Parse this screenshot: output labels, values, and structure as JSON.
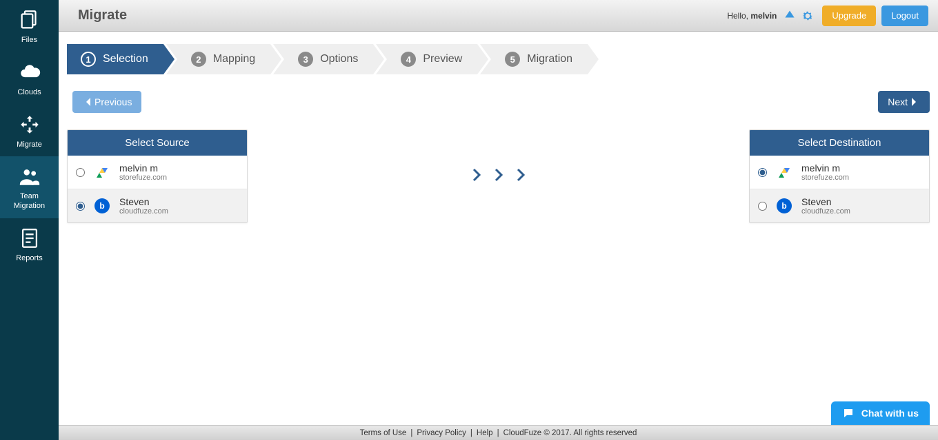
{
  "sidebar": {
    "items": [
      {
        "label": "Files"
      },
      {
        "label": "Clouds"
      },
      {
        "label": "Migrate"
      },
      {
        "label": "Team\nMigration"
      },
      {
        "label": "Reports"
      }
    ]
  },
  "header": {
    "title": "Migrate",
    "hello_prefix": "Hello, ",
    "username": "melvin",
    "upgrade_label": "Upgrade",
    "logout_label": "Logout"
  },
  "wizard": {
    "steps": [
      {
        "num": "1",
        "label": "Selection"
      },
      {
        "num": "2",
        "label": "Mapping"
      },
      {
        "num": "3",
        "label": "Options"
      },
      {
        "num": "4",
        "label": "Preview"
      },
      {
        "num": "5",
        "label": "Migration"
      }
    ],
    "prev_label": "Previous",
    "next_label": "Next"
  },
  "source": {
    "title": "Select Source",
    "items": [
      {
        "name": "melvin m",
        "domain": "storefuze.com",
        "icon": "gdrive",
        "selected": false
      },
      {
        "name": "Steven",
        "domain": "cloudfuze.com",
        "icon": "box",
        "selected": true
      }
    ]
  },
  "dest": {
    "title": "Select Destination",
    "items": [
      {
        "name": "melvin m",
        "domain": "storefuze.com",
        "icon": "gdrive",
        "selected": true
      },
      {
        "name": "Steven",
        "domain": "cloudfuze.com",
        "icon": "box",
        "selected": false
      }
    ]
  },
  "footer": {
    "tos": "Terms of Use",
    "privacy": "Privacy Policy",
    "help": "Help",
    "copyright": "CloudFuze © 2017. All rights reserved"
  },
  "chat": {
    "label": "Chat with us"
  }
}
